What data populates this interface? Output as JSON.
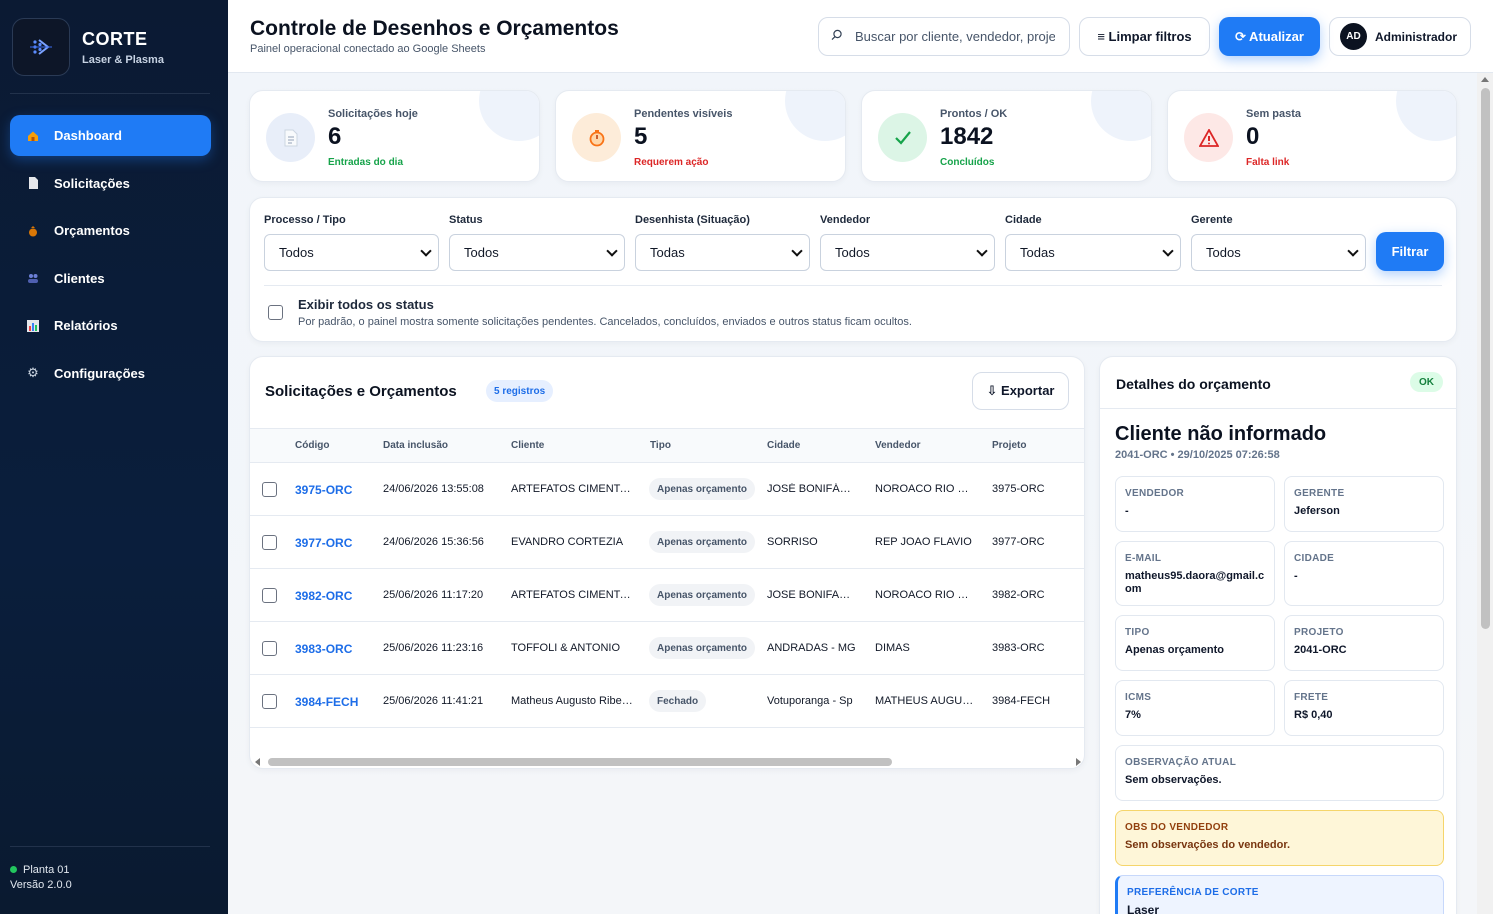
{
  "brand": {
    "name": "CORTE",
    "subtitle": "Laser & Plasma"
  },
  "sidebar": {
    "items": [
      {
        "label": "Dashboard",
        "icon": "home-icon",
        "active": true
      },
      {
        "label": "Solicitações",
        "icon": "document-icon"
      },
      {
        "label": "Orçamentos",
        "icon": "money-bag-icon"
      },
      {
        "label": "Clientes",
        "icon": "users-icon"
      },
      {
        "label": "Relatórios",
        "icon": "chart-icon"
      },
      {
        "label": "Configurações",
        "icon": "gear-icon"
      }
    ],
    "footer": {
      "plant": "Planta 01",
      "version": "Versão 2.0.0"
    }
  },
  "header": {
    "title": "Controle de Desenhos e Orçamentos",
    "subtitle": "Painel operacional conectado ao Google Sheets",
    "search_placeholder": "Buscar por cliente, vendedor, projeto...",
    "clear_label": "≡ Limpar filtros",
    "refresh_label": "⟳ Atualizar",
    "user": {
      "initials": "AD",
      "name": "Administrador"
    }
  },
  "stats": [
    {
      "label": "Solicitações hoje",
      "value": "6",
      "sub": "Entradas do dia",
      "sub_color": "#16a34a",
      "icon": "document-icon",
      "icon_bg": "#e8eef9"
    },
    {
      "label": "Pendentes visíveis",
      "value": "5",
      "sub": "Requerem ação",
      "sub_color": "#dc2626",
      "icon": "timer-icon",
      "icon_bg": "#fdecd9"
    },
    {
      "label": "Prontos / OK",
      "value": "1842",
      "sub": "Concluídos",
      "sub_color": "#16a34a",
      "icon": "check-icon",
      "icon_bg": "#dcf5e6"
    },
    {
      "label": "Sem pasta",
      "value": "0",
      "sub": "Falta link",
      "sub_color": "#dc2626",
      "icon": "warning-icon",
      "icon_bg": "#fde8e6"
    }
  ],
  "filters": {
    "fields": [
      {
        "label": "Processo / Tipo",
        "value": "Todos"
      },
      {
        "label": "Status",
        "value": "Todos"
      },
      {
        "label": "Desenhista (Situação)",
        "value": "Todas"
      },
      {
        "label": "Vendedor",
        "value": "Todos"
      },
      {
        "label": "Cidade",
        "value": "Todas"
      },
      {
        "label": "Gerente",
        "value": "Todos"
      }
    ],
    "filter_button": "Filtrar",
    "show_all_label": "Exibir todos os status",
    "show_all_help": "Por padrão, o painel mostra somente solicitações pendentes. Cancelados, concluídos, enviados e outros status ficam ocultos."
  },
  "table": {
    "title": "Solicitações e Orçamentos",
    "count_badge": "5 registros",
    "export_label": "⇩ Exportar",
    "columns": [
      "Código",
      "Data inclusão",
      "Cliente",
      "Tipo",
      "Cidade",
      "Vendedor",
      "Projeto"
    ],
    "rows": [
      {
        "code": "3975-ORC",
        "date": "24/06/2026 13:55:08",
        "client": "ARTEFATOS CIMENTADOS",
        "type": "Apenas orçamento",
        "city": "JOSÉ BONIFÁCIO",
        "seller": "NOROACO RIO PRETO",
        "project": "3975-ORC"
      },
      {
        "code": "3977-ORC",
        "date": "24/06/2026 15:36:56",
        "client": "EVANDRO CORTEZIA",
        "type": "Apenas orçamento",
        "city": "SORRISO",
        "seller": "REP JOAO FLAVIO",
        "project": "3977-ORC"
      },
      {
        "code": "3982-ORC",
        "date": "25/06/2026 11:17:20",
        "client": "ARTEFATOS CIMENTADOS",
        "type": "Apenas orçamento",
        "city": "JOSE BONIFACIO",
        "seller": "NOROACO RIO PRETO",
        "project": "3982-ORC"
      },
      {
        "code": "3983-ORC",
        "date": "25/06/2026 11:23:16",
        "client": "TOFFOLI & ANTONIO",
        "type": "Apenas orçamento",
        "city": "ANDRADAS - MG",
        "seller": "DIMAS",
        "project": "3983-ORC"
      },
      {
        "code": "3984-FECH",
        "date": "25/06/2026 11:41:21",
        "client": "Matheus Augusto Ribeiro",
        "type": "Fechado",
        "city": "Votuporanga - Sp",
        "seller": "MATHEUS AUGUSTO",
        "project": "3984-FECH"
      }
    ]
  },
  "details": {
    "title": "Detalhes do orçamento",
    "status_badge": "OK",
    "client": "Cliente não informado",
    "meta": "2041-ORC • 29/10/2025 07:26:58",
    "fields": {
      "vendedor": {
        "k": "VENDEDOR",
        "v": "-"
      },
      "gerente": {
        "k": "GERENTE",
        "v": "Jeferson"
      },
      "email": {
        "k": "E-MAIL",
        "v": "matheus95.daora@gmail.com"
      },
      "cidade": {
        "k": "CIDADE",
        "v": "-"
      },
      "tipo": {
        "k": "TIPO",
        "v": "Apenas orçamento"
      },
      "projeto": {
        "k": "PROJETO",
        "v": "2041-ORC"
      },
      "icms": {
        "k": "ICMS",
        "v": "7%"
      },
      "frete": {
        "k": "FRETE",
        "v": "R$ 0,40"
      },
      "obs": {
        "k": "OBSERVAÇÃO ATUAL",
        "v": "Sem observações."
      },
      "obs_vendedor": {
        "k": "OBS DO VENDEDOR",
        "v": "Sem observações do vendedor."
      },
      "pref_corte": {
        "k": "PREFERÊNCIA DE CORTE",
        "v": "Laser"
      }
    }
  }
}
